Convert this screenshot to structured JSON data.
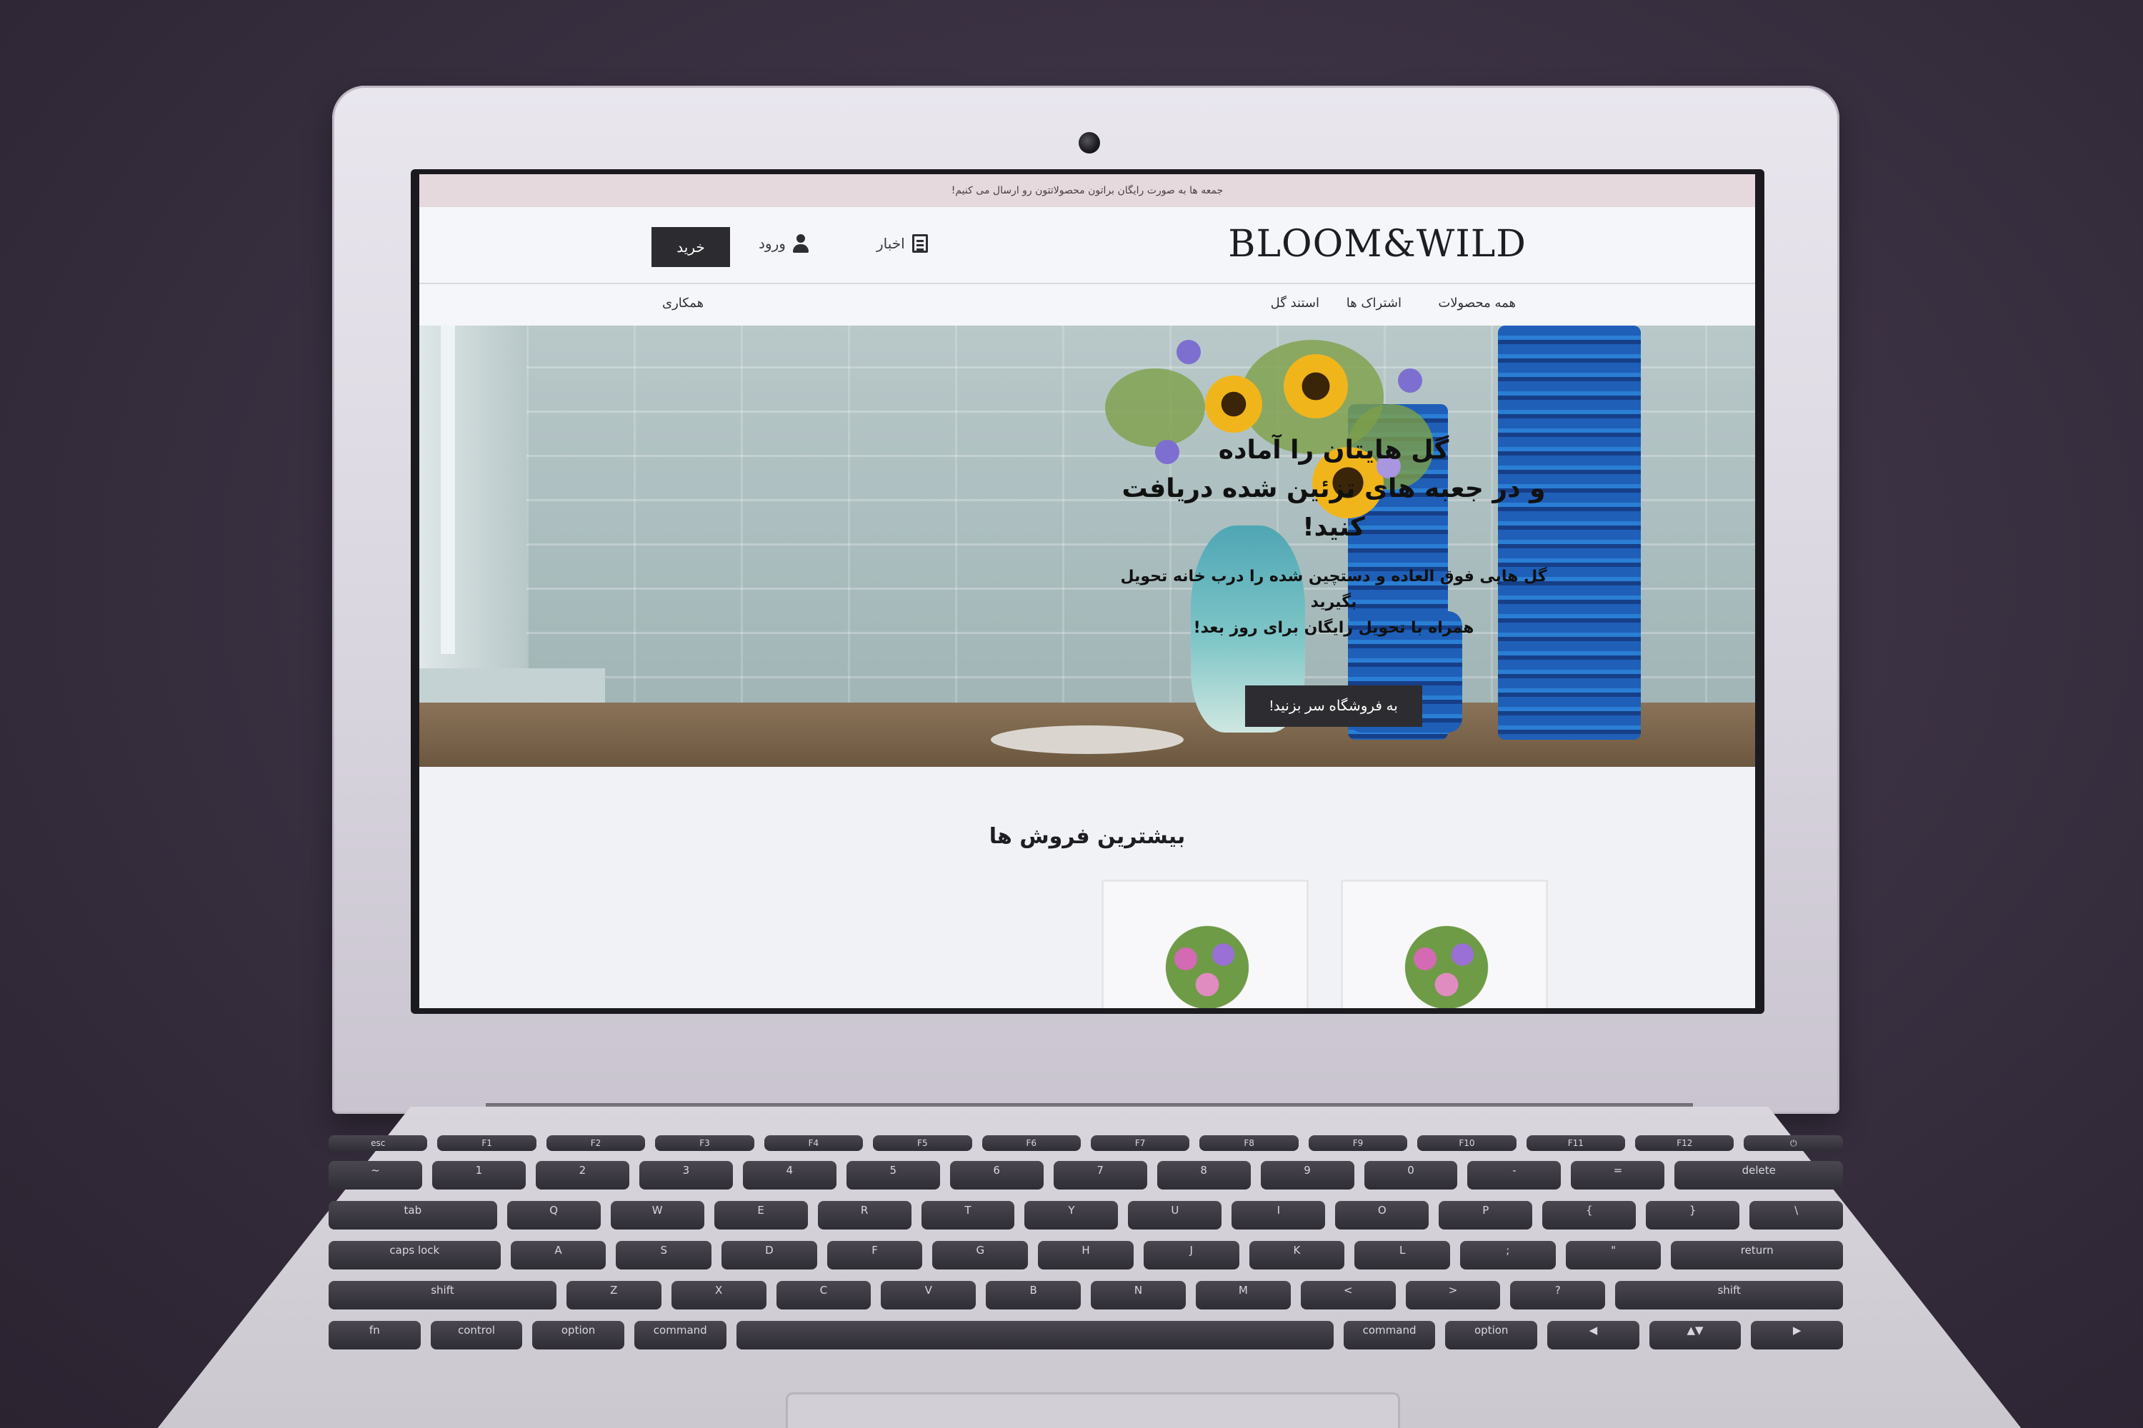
{
  "promo_bar": {
    "text": "جمعه ها به صورت رایگان براتون محصولاتتون رو ارسال می کنیم!"
  },
  "header": {
    "logo": "BLOOM&WILD",
    "news_label": "اخبار",
    "login_label": "ورود",
    "buy_label": "خرید"
  },
  "nav": {
    "items": [
      "همه محصولات",
      "اشتراک ها",
      "استند گل"
    ],
    "partner_label": "همکاری"
  },
  "hero": {
    "title_line1": "گل هایتان را آماده",
    "title_line2": "و در جعبه های تزئین شده دریافت کنید!",
    "sub_line1": "گل هایی فوق العاده و دستچین شده را درب خانه تحویل بگیرید",
    "sub_line2": "همراه با تحویل رایگان برای روز بعد!",
    "cta_label": "به فروشگاه سر بزنید!"
  },
  "bestsellers": {
    "title": "بیشترین فروش ها"
  },
  "keyboard": {
    "row1": [
      "esc",
      "F1",
      "F2",
      "F3",
      "F4",
      "F5",
      "F6",
      "F7",
      "F8",
      "F9",
      "F10",
      "F11",
      "F12",
      "⏻"
    ],
    "row2": [
      "~",
      "1",
      "2",
      "3",
      "4",
      "5",
      "6",
      "7",
      "8",
      "9",
      "0",
      "-",
      "=",
      "delete"
    ],
    "row3": [
      "tab",
      "Q",
      "W",
      "E",
      "R",
      "T",
      "Y",
      "U",
      "I",
      "O",
      "P",
      "{",
      "}",
      "\\"
    ],
    "row4": [
      "caps lock",
      "A",
      "S",
      "D",
      "F",
      "G",
      "H",
      "J",
      "K",
      "L",
      ";",
      "\"",
      "return"
    ],
    "row5": [
      "shift",
      "Z",
      "X",
      "C",
      "V",
      "B",
      "N",
      "M",
      "<",
      ">",
      "?",
      "shift"
    ],
    "row6": [
      "fn",
      "control",
      "option",
      "command",
      "",
      "command",
      "option",
      "◀",
      "▲▼",
      "▶"
    ]
  },
  "colors": {
    "promo_bg": "#e6d9de",
    "button_dark": "#2c2c30",
    "page_bg": "#f1f2f6"
  }
}
